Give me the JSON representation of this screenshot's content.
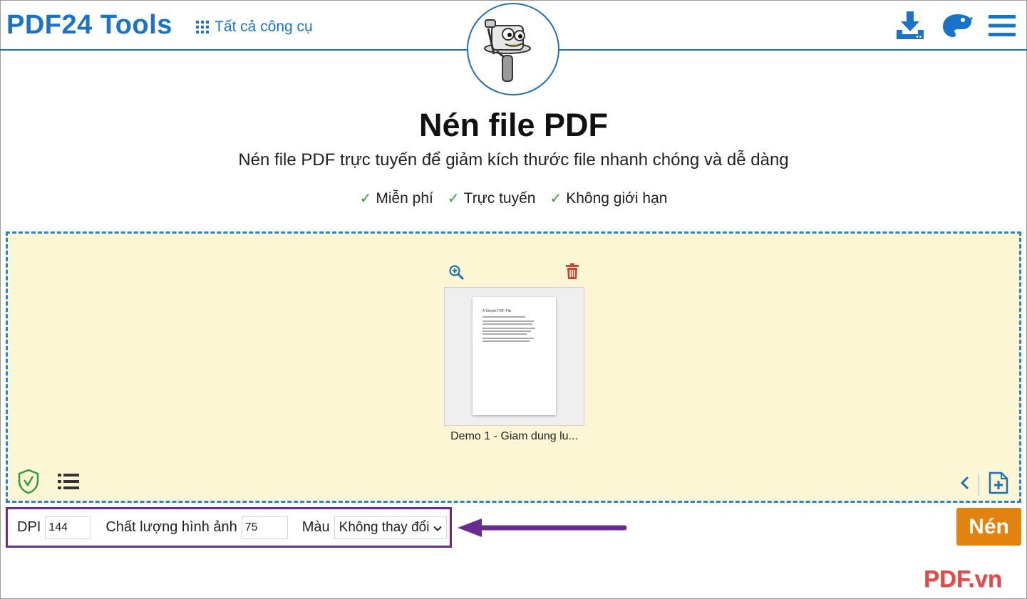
{
  "header": {
    "brand": "PDF24 Tools",
    "all_tools_label": "Tất cả công cụ",
    "icons": [
      "download-app-icon",
      "palette-icon",
      "hamburger-menu-icon"
    ],
    "mascot": "pdf24-mascot-logo"
  },
  "main": {
    "title": "Nén file PDF",
    "subtitle": "Nén file PDF trực tuyến để giảm kích thước file nhanh chóng và dễ dàng",
    "features": [
      "Miễn phí",
      "Trực tuyến",
      "Không giới hạn"
    ]
  },
  "file": {
    "name": "Demo 1 - Giam dung lu...",
    "preview_title": "A Simple PDF File"
  },
  "options": {
    "dpi_label": "DPI",
    "dpi_value": "144",
    "quality_label": "Chất lượng hình ảnh",
    "quality_value": "75",
    "color_label": "Màu",
    "color_value": "Không thay đổi"
  },
  "actions": {
    "compress_label": "Nén"
  },
  "watermark": "PDF.vn",
  "colors": {
    "brand_blue": "#1a73c6",
    "dropzone_bg": "#fdf6d4",
    "button_orange": "#e2820f",
    "annotation_purple": "#6b2c8f",
    "check_green": "#2e9e3e"
  }
}
